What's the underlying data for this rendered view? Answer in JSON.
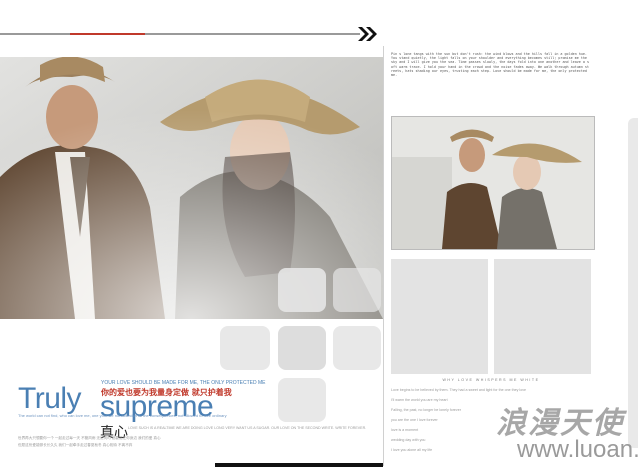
{
  "header": {
    "nav_arrow_icon": "double-chevron-right-icon"
  },
  "body_text": "Pin s lone tangs with the sun but don't rush: the wind blows and the hills fall in a golden hue. You stand quietly, the light falls on your shoulder and everything becomes still; promise me the sky and I will give you the sea. Time passes slowly, the days fold into one another and leave a soft warm trace. I hold your hand in the crowd and the noise fades away. We walk through autumn streets, hats shading our eyes, trusting each step. Love should be made for me, the only protected me.",
  "headline": {
    "word1": "Truly",
    "word2": "supreme",
    "small_en": "YOUR LOVE SHOULD BE MADE FOR ME, THE ONLY PROTECTED ME",
    "cn_red": "你的爱也要为我量身定做 就只护着我",
    "tiny_blue": "The world can not find, who can love me, one your we not abandon all the consequences, not allowed to love ordinary",
    "zhenxin": "真心",
    "gray_line1": "LOVE SUCH IS A REALTIME WE ARE DOING LOVE LONG VERY WANT US A SUGAR. OUR LOVE ON THE SECOND WRITE. WRITE FOREVER.",
    "gray_line2": "世界再大只想要你一个 一起走过每一天 不管风雨 无论何时 都要陪在你身边 我们的爱 真心",
    "gray_line3": "但愿这份爱能够长长久久 我们一起牵手走过春夏秋冬 真心相待 不离不弃"
  },
  "right_text_lines": [
    "WHY LOVE WHISPERS ME WHITE",
    "Love begins to be believed by them. They had a sweet and light for the one they love",
    "I'll warm the world you are my heart",
    "Falling, the past, no longer be lonely forever",
    "you are the one I love forever",
    "love is a moment",
    "wedding day with you",
    "I love you alone all my life"
  ],
  "watermark": {
    "text": "浪漫天使",
    "site": "www.luoan.cn"
  },
  "colors": {
    "accent_blue": "#4a7fb3",
    "accent_red": "#c0392b"
  }
}
